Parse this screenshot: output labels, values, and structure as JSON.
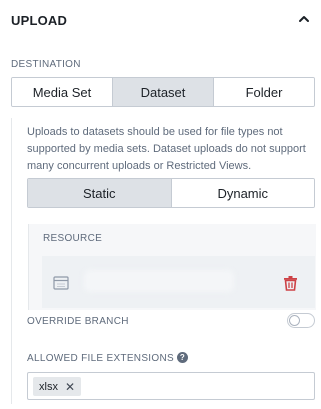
{
  "header": {
    "title": "UPLOAD",
    "collapse_icon": "chevron-up-icon"
  },
  "destination": {
    "label": "DESTINATION",
    "options": [
      "Media Set",
      "Dataset",
      "Folder"
    ],
    "selected": "Dataset"
  },
  "info_text": "Uploads to datasets should be used for file types not supported by media sets. Dataset uploads do not support many concurrent uploads or Restricted Views.",
  "mode": {
    "options": [
      "Static",
      "Dynamic"
    ],
    "selected": "Static"
  },
  "resource": {
    "label": "RESOURCE",
    "icon": "dataset-icon",
    "delete_icon": "trash-icon"
  },
  "override_branch": {
    "label": "OVERRIDE BRANCH",
    "enabled": false
  },
  "allowed_extensions": {
    "label": "ALLOWED FILE EXTENSIONS",
    "help_icon": "help-icon",
    "help_glyph": "?",
    "tags": [
      {
        "value": "xlsx",
        "remove_glyph": "✕"
      }
    ]
  },
  "colors": {
    "accent_danger": "#cd4246",
    "selected_segment": "#dde1e6",
    "border": "#c5cbd3"
  }
}
